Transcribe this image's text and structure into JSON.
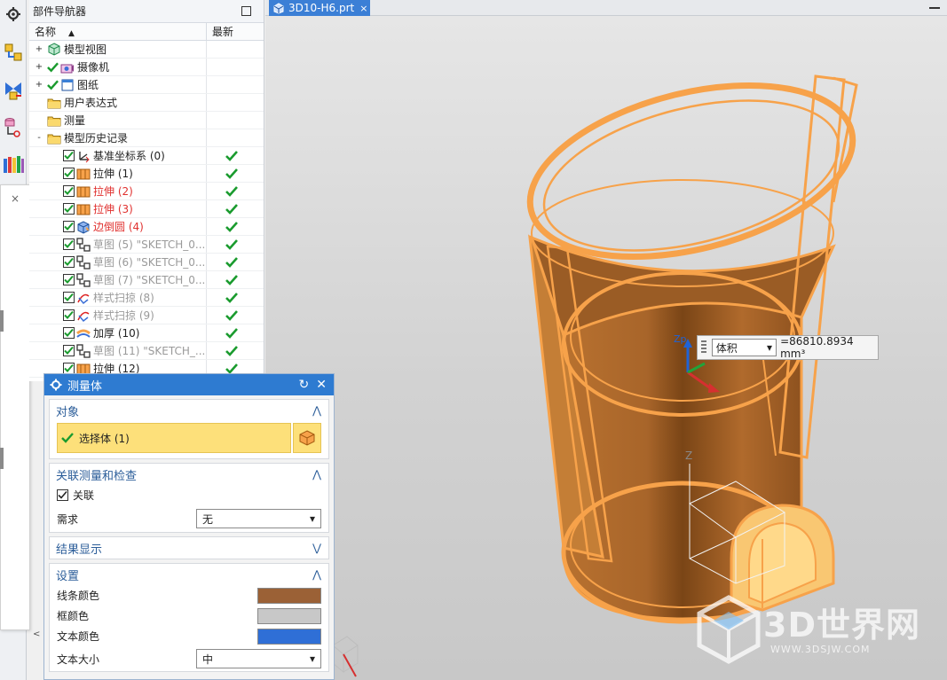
{
  "resource_bar": {
    "icons": [
      "gear-icon",
      "assembly-navigator-icon",
      "constraint-navigator-icon",
      "part-navigator-icon",
      "reuse-library-icon"
    ]
  },
  "part_navigator": {
    "title": "部件导航器",
    "columns": {
      "name": "名称",
      "latest": "最新"
    },
    "rows": [
      {
        "label": "模型视图",
        "toggle": "+",
        "icon": "model-view-icon",
        "check": "none",
        "latest": false,
        "style": "normal",
        "indent": 0
      },
      {
        "label": "摄像机",
        "toggle": "+",
        "icon": "camera-icon",
        "check": "green",
        "latest": false,
        "style": "normal",
        "indent": 0
      },
      {
        "label": "图纸",
        "toggle": "+",
        "icon": "drawing-icon",
        "check": "green",
        "latest": false,
        "style": "normal",
        "indent": 0
      },
      {
        "label": "用户表达式",
        "toggle": "",
        "icon": "folder-icon",
        "check": "none",
        "latest": false,
        "style": "normal",
        "indent": 0
      },
      {
        "label": "测量",
        "toggle": "",
        "icon": "folder-icon",
        "check": "none",
        "latest": false,
        "style": "normal",
        "indent": 0
      },
      {
        "label": "模型历史记录",
        "toggle": "-",
        "icon": "folder-icon",
        "check": "none",
        "latest": false,
        "style": "normal",
        "indent": 0
      },
      {
        "label": "基准坐标系 (0)",
        "toggle": "",
        "icon": "datum-csys-icon",
        "check": "box",
        "latest": true,
        "style": "normal",
        "indent": 1
      },
      {
        "label": "拉伸 (1)",
        "toggle": "",
        "icon": "extrude-icon",
        "check": "box",
        "latest": true,
        "style": "normal",
        "indent": 1
      },
      {
        "label": "拉伸 (2)",
        "toggle": "",
        "icon": "extrude-icon",
        "check": "box",
        "latest": true,
        "style": "red",
        "indent": 1
      },
      {
        "label": "拉伸 (3)",
        "toggle": "",
        "icon": "extrude-icon",
        "check": "box",
        "latest": true,
        "style": "red",
        "indent": 1
      },
      {
        "label": "边倒圆 (4)",
        "toggle": "",
        "icon": "edge-blend-icon",
        "check": "box",
        "latest": true,
        "style": "red",
        "indent": 1
      },
      {
        "label": "草图 (5) \"SKETCH_0...",
        "toggle": "",
        "icon": "sketch-icon",
        "check": "box",
        "latest": true,
        "style": "grey",
        "indent": 1
      },
      {
        "label": "草图 (6) \"SKETCH_0...",
        "toggle": "",
        "icon": "sketch-icon",
        "check": "box",
        "latest": true,
        "style": "grey",
        "indent": 1
      },
      {
        "label": "草图 (7) \"SKETCH_0...",
        "toggle": "",
        "icon": "sketch-icon",
        "check": "box",
        "latest": true,
        "style": "grey",
        "indent": 1
      },
      {
        "label": "样式扫掠 (8)",
        "toggle": "",
        "icon": "styled-sweep-icon",
        "check": "box",
        "latest": true,
        "style": "grey",
        "indent": 1
      },
      {
        "label": "样式扫掠 (9)",
        "toggle": "",
        "icon": "styled-sweep-icon",
        "check": "box",
        "latest": true,
        "style": "grey",
        "indent": 1
      },
      {
        "label": "加厚 (10)",
        "toggle": "",
        "icon": "thicken-icon",
        "check": "box",
        "latest": true,
        "style": "normal",
        "indent": 1
      },
      {
        "label": "草图 (11) \"SKETCH_...",
        "toggle": "",
        "icon": "sketch-icon",
        "check": "box",
        "latest": true,
        "style": "grey",
        "indent": 1
      },
      {
        "label": "拉伸 (12)",
        "toggle": "",
        "icon": "extrude-icon",
        "check": "box",
        "latest": true,
        "style": "normal",
        "indent": 1
      }
    ]
  },
  "tab": {
    "label": "3D10-H6.prt",
    "close": "×"
  },
  "readout": {
    "option": "体积",
    "value": "=86810.8934 mm³"
  },
  "axes": {
    "zp": "Zp",
    "z": "Z"
  },
  "dialog": {
    "title": "测量体",
    "reset_icon": "↻",
    "close_icon": "✕",
    "object_section": {
      "title": "对象",
      "select_label": "选择体 (1)"
    },
    "assoc_section": {
      "title": "关联测量和检查",
      "assoc_label": "关联",
      "assoc_checked": true,
      "requirement_label": "需求",
      "requirement_value": "无"
    },
    "result_section": {
      "title": "结果显示"
    },
    "settings_section": {
      "title": "设置",
      "line_color_label": "线条颜色",
      "line_color": "#9b6136",
      "box_color_label": "框颜色",
      "box_color": "#c8c8c8",
      "text_color_label": "文本颜色",
      "text_color": "#2f6fd6",
      "text_size_label": "文本大小",
      "text_size_value": "中"
    }
  },
  "watermark": {
    "text": "3D世界网",
    "url": "WWW.3DSJW.COM"
  },
  "colors": {
    "accent": "#2e7bd1",
    "model_orange": "#f7a24a",
    "check_green": "#1a9b2e"
  }
}
